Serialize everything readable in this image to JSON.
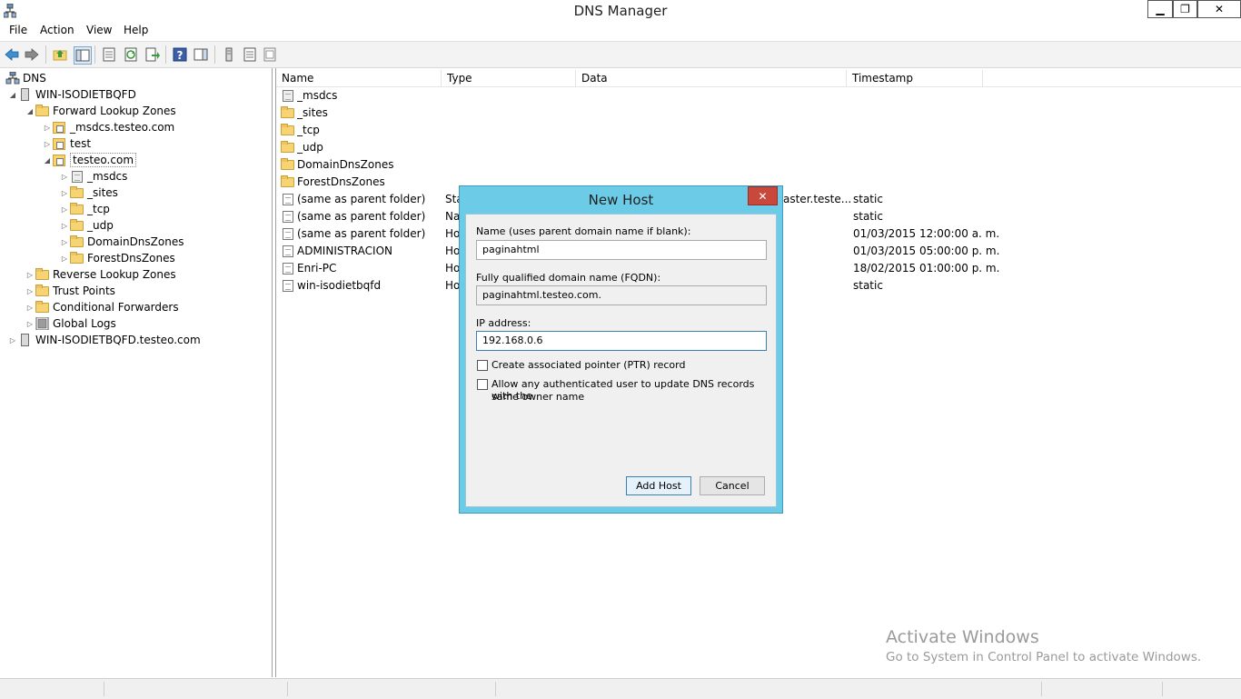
{
  "window": {
    "title": "DNS Manager",
    "minimize_glyph": "▁",
    "maximize_glyph": "❐",
    "close_glyph": "✕"
  },
  "menu": {
    "items": [
      "File",
      "Action",
      "View",
      "Help"
    ]
  },
  "toolbar": {
    "icons": [
      "back-arrow-icon",
      "forward-arrow-icon",
      "up-folder-icon",
      "show-hide-tree-icon",
      "properties-icon",
      "refresh-icon",
      "export-list-icon",
      "help-icon",
      "action-pane-icon",
      "server-icon",
      "list-icon",
      "record-icon"
    ]
  },
  "tree": {
    "root": "DNS",
    "nodes": [
      {
        "label": "WIN-ISODIETBQFD",
        "icon": "server-icon"
      },
      {
        "label": "Forward Lookup Zones",
        "icon": "folder-icon"
      },
      {
        "label": "_msdcs.testeo.com",
        "icon": "zone-icon"
      },
      {
        "label": "test",
        "icon": "zone-icon"
      },
      {
        "label": "testeo.com",
        "icon": "zone-icon"
      },
      {
        "label": "_msdcs",
        "icon": "zone-icon"
      },
      {
        "label": "_sites",
        "icon": "folder-icon"
      },
      {
        "label": "_tcp",
        "icon": "folder-icon"
      },
      {
        "label": "_udp",
        "icon": "folder-icon"
      },
      {
        "label": "DomainDnsZones",
        "icon": "folder-icon"
      },
      {
        "label": "ForestDnsZones",
        "icon": "folder-icon"
      },
      {
        "label": "Reverse Lookup Zones",
        "icon": "folder-icon"
      },
      {
        "label": "Trust Points",
        "icon": "folder-icon"
      },
      {
        "label": "Conditional Forwarders",
        "icon": "folder-icon"
      },
      {
        "label": "Global Logs",
        "icon": "log-icon"
      },
      {
        "label": "WIN-ISODIETBQFD.testeo.com",
        "icon": "server-icon"
      }
    ]
  },
  "list": {
    "columns": [
      "Name",
      "Type",
      "Data",
      "Timestamp"
    ],
    "rows": [
      {
        "name": "_msdcs",
        "type": "",
        "data": "",
        "timestamp": "",
        "icon": "zone-icon"
      },
      {
        "name": "_sites",
        "type": "",
        "data": "",
        "timestamp": "",
        "icon": "folder-icon"
      },
      {
        "name": "_tcp",
        "type": "",
        "data": "",
        "timestamp": "",
        "icon": "folder-icon"
      },
      {
        "name": "_udp",
        "type": "",
        "data": "",
        "timestamp": "",
        "icon": "folder-icon"
      },
      {
        "name": "DomainDnsZones",
        "type": "",
        "data": "",
        "timestamp": "",
        "icon": "folder-icon"
      },
      {
        "name": "ForestDnsZones",
        "type": "",
        "data": "",
        "timestamp": "",
        "icon": "folder-icon"
      },
      {
        "name": "(same as parent folder)",
        "type": "Sta",
        "data": "aster.teste...",
        "timestamp": "static",
        "icon": "record-icon"
      },
      {
        "name": "(same as parent folder)",
        "type": "Na",
        "data": "",
        "timestamp": "static",
        "icon": "record-icon"
      },
      {
        "name": "(same as parent folder)",
        "type": "Ho",
        "data": "",
        "timestamp": "01/03/2015 12:00:00 a. m.",
        "icon": "record-icon"
      },
      {
        "name": "ADMINISTRACION",
        "type": "Ho",
        "data": "",
        "timestamp": "01/03/2015 05:00:00 p. m.",
        "icon": "record-icon"
      },
      {
        "name": "Enri-PC",
        "type": "Ho",
        "data": "",
        "timestamp": "18/02/2015 01:00:00 p. m.",
        "icon": "record-icon"
      },
      {
        "name": "win-isodietbqfd",
        "type": "Ho",
        "data": "",
        "timestamp": "static",
        "icon": "record-icon"
      }
    ]
  },
  "dialog": {
    "title": "New Host",
    "close_glyph": "✕",
    "name_label": "Name (uses parent domain name if blank):",
    "name_value": "paginahtml",
    "fqdn_label": "Fully qualified domain name (FQDN):",
    "fqdn_value": "paginahtml.testeo.com.",
    "ip_label": "IP address:",
    "ip_value": "192.168.0.6",
    "ptr_label": "Create associated pointer (PTR) record",
    "auth_label_line1": "Allow any authenticated user to update DNS records with the",
    "auth_label_line2": "same owner name",
    "add_host_label": "Add Host",
    "cancel_label": "Cancel"
  },
  "watermark": {
    "title": "Activate Windows",
    "subtitle": "Go to System in Control Panel to activate Windows."
  }
}
